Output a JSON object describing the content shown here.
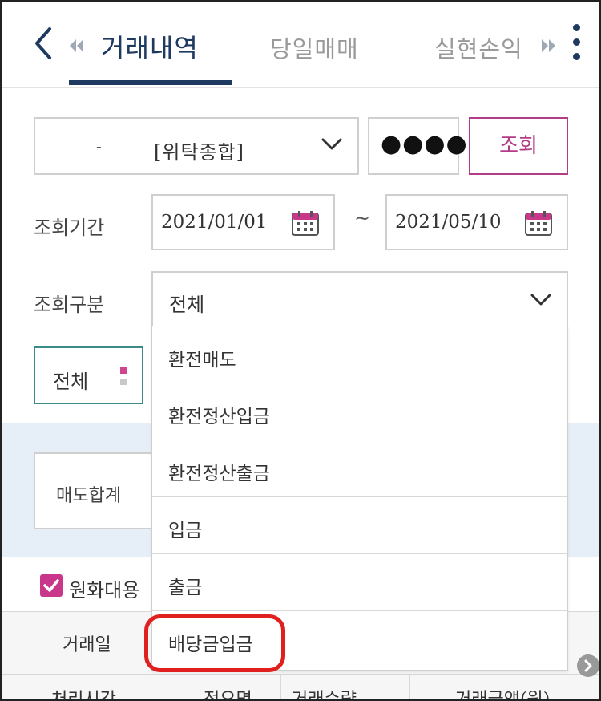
{
  "header": {
    "tabs": [
      {
        "label": "거래내역",
        "active": true
      },
      {
        "label": "당일매매",
        "active": false
      },
      {
        "label": "실현손익",
        "active": false
      }
    ]
  },
  "account": {
    "dash": "-",
    "name": "[위탁종합]",
    "password_mask": "●●●●",
    "query_label": "조회"
  },
  "period": {
    "label": "조회기간",
    "start": "2021/01/01",
    "separator": "~",
    "end": "2021/05/10"
  },
  "kind": {
    "label": "조회구분",
    "selected": "전체",
    "options": [
      "환전매도",
      "환전정산입금",
      "환전정산출금",
      "입금",
      "출금",
      "배당금입금"
    ],
    "highlighted_option": "배당금입금"
  },
  "filter": {
    "label": "전체"
  },
  "summary": {
    "sell_total_label": "매도합계"
  },
  "checkbox": {
    "label": "원화대용",
    "checked": true
  },
  "table": {
    "header_row1": [
      "거래일"
    ],
    "header_row2": [
      "처리시간",
      "적요명",
      "거래수량",
      "거래금액(원)"
    ]
  },
  "colors": {
    "navy": "#1f3a60",
    "accent": "#b33c88",
    "teal": "#3a8c8c",
    "highlight_red": "#e01f1f",
    "band": "#e6eef7"
  }
}
